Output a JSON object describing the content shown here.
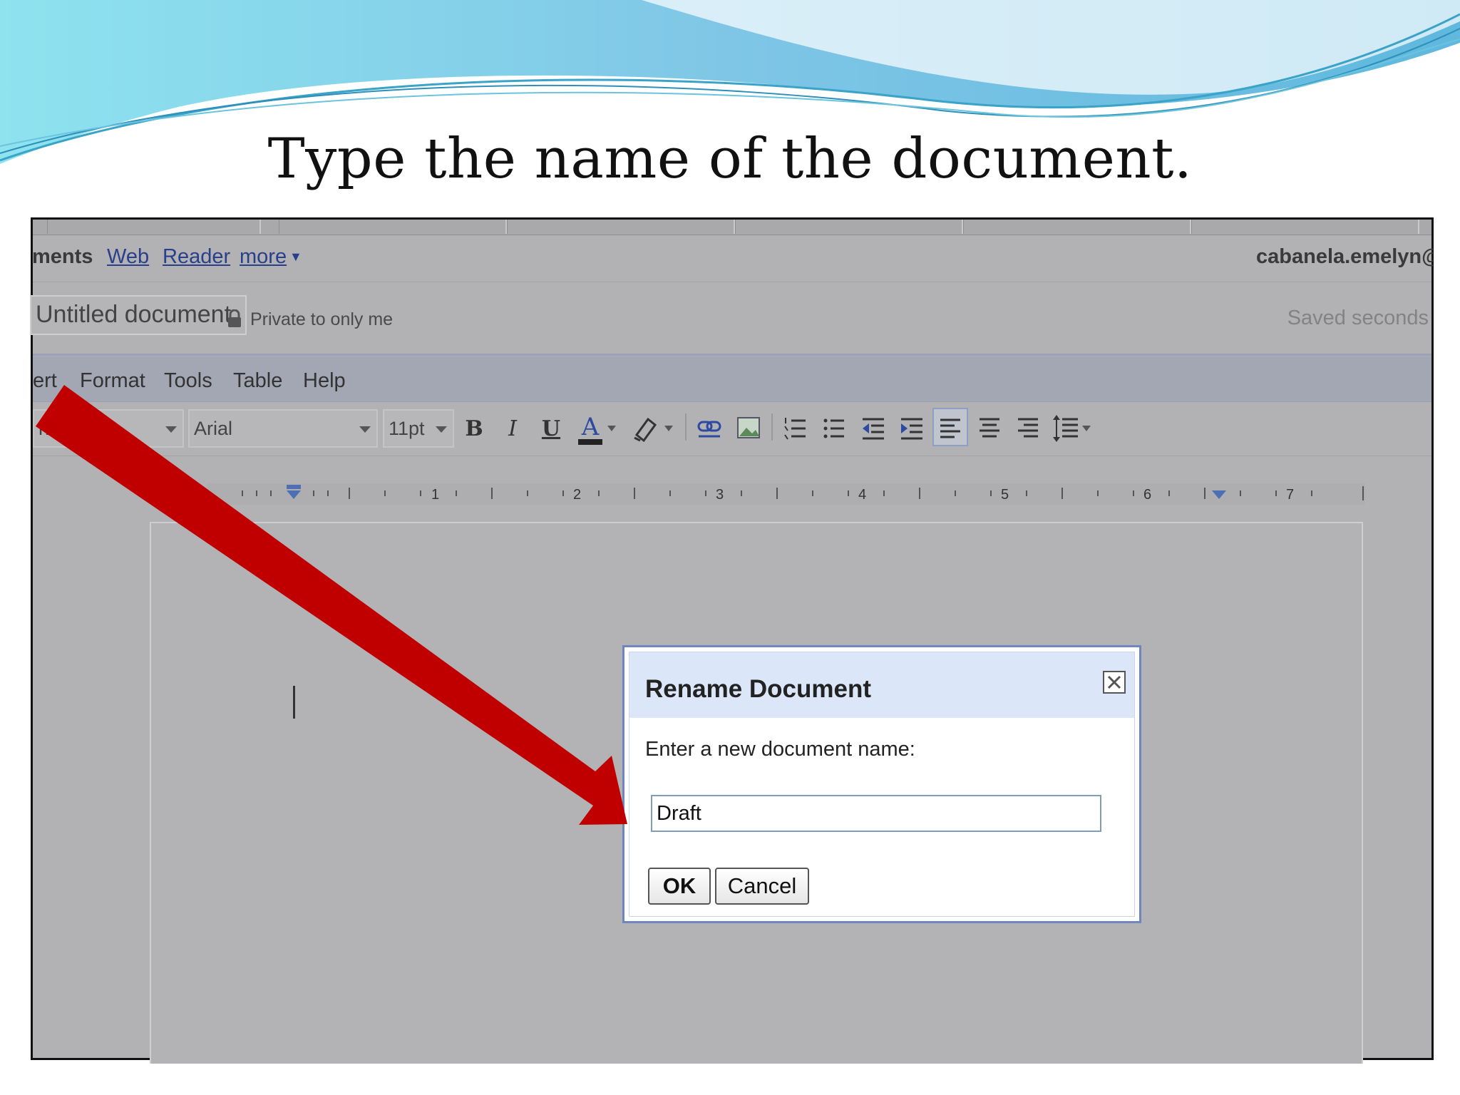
{
  "slide": {
    "title": "Type the name of the document."
  },
  "colors": {
    "arrow": "#c00000",
    "wave_light": "#9fdcef",
    "wave_dark": "#59c3dd",
    "dialog_header": "#dbe6f8",
    "link": "#2a3f8c"
  },
  "gbar": {
    "section": "ments",
    "links": [
      "Web",
      "Reader",
      "more"
    ],
    "more_arrow": "▼",
    "email": "cabanela.emelyn@gn"
  },
  "doc": {
    "title": "Untitled document",
    "privacy": "Private to only me",
    "saved_status": "Saved seconds"
  },
  "menu": {
    "items": [
      "ert",
      "Format",
      "Tools",
      "Table",
      "Help"
    ]
  },
  "toolbar": {
    "style_value": "na",
    "font_value": "Arial",
    "size_value": "11pt",
    "bold": "B",
    "italic": "I",
    "underline": "U",
    "text_color": "A"
  },
  "ruler": {
    "numbers": [
      "1",
      "2",
      "3",
      "4",
      "5",
      "6",
      "7"
    ]
  },
  "dialog": {
    "title": "Rename Document",
    "close_symbol": "×",
    "prompt": "Enter a new document name:",
    "input_value": "Draft",
    "ok_label": "OK",
    "cancel_label": "Cancel"
  }
}
